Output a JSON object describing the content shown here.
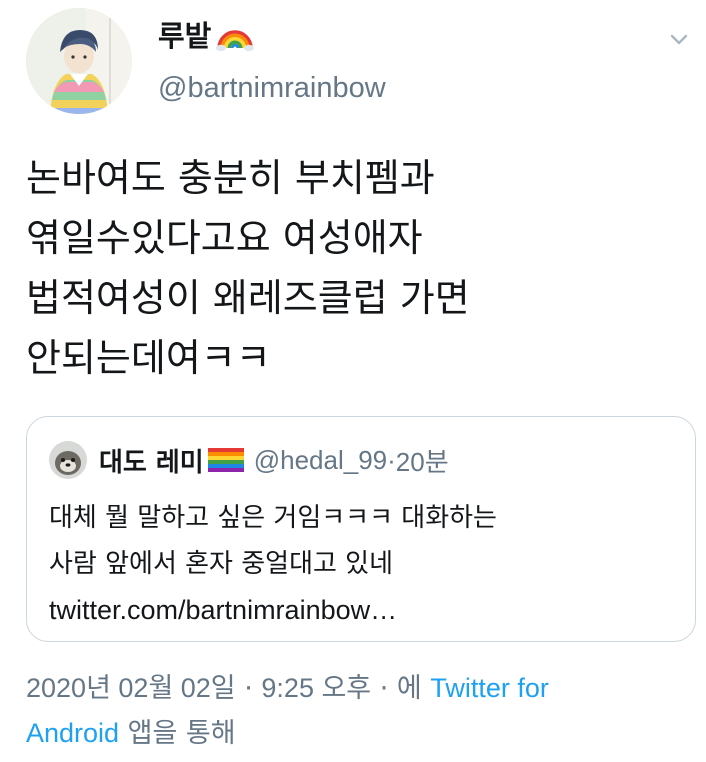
{
  "user": {
    "display_name": "루밭",
    "name_emoji": "rainbow",
    "handle": "@bartnimrainbow",
    "avatar_icon": "drawn-portrait-avatar"
  },
  "menu_icon": "chevron-down-icon",
  "tweet": {
    "lines": [
      "논바여도 충분히 부치펨과",
      "엮일수있다고요 여성애자",
      "법적여성이 왜레즈클럽 가면",
      "안되는데여ㅋㅋ"
    ]
  },
  "quote": {
    "display_name": "대도 레미",
    "name_emoji": "rainbow-flag",
    "handle": "@hedal_99",
    "separator": " · ",
    "time": "20분",
    "lines": [
      "대체 뭘 말하고 싶은 거임ㅋㅋㅋ 대화하는",
      "사람 앞에서 혼자 중얼대고 있네"
    ],
    "link": "twitter.com/bartnimrainbow…"
  },
  "footer": {
    "date": "2020년 02월 02일",
    "sep1": " · ",
    "time": "9:25 오후",
    "sep2": " · ",
    "via_prefix": "에 ",
    "app_part1": "Twitter for",
    "app_part2": "Android",
    "via_suffix": " 앱을 통해"
  },
  "colors": {
    "text": "#14171a",
    "secondary": "#657786",
    "link": "#1da1f2",
    "border": "#ccd6dd"
  }
}
